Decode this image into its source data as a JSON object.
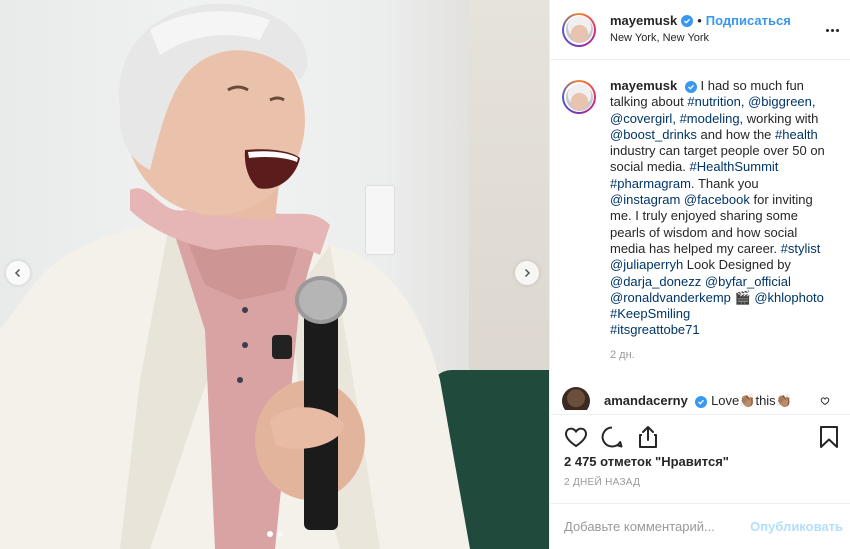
{
  "post": {
    "username": "mayemusk",
    "follow_label": "Подписаться",
    "separator": "•",
    "location": "New York, New York",
    "caption_lines": [
      "I had so much fun",
      "talking about #nutrition, @biggreen,",
      "@covergirl, #modeling, working with",
      "@boost_drinks and how the #health",
      "industry can target people over 50 on",
      "social media. #HealthSummit",
      "#pharmagram. Thank you",
      "@instagram @facebook for inviting",
      "me. I truly enjoyed sharing some",
      "pearls of wisdom and how social",
      "media has helped my career. #stylist",
      "@juliaperryh Look Designed by",
      "@darja_donezz @byfar_official",
      "@ronaldvanderkemp 🎬 @khlophoto",
      "#KeepSmiling",
      "#itsgreattobe71"
    ],
    "caption_time": "2 дн.",
    "likes_text": "2 475 отметок \"Нравится\"",
    "date_text": "2 ДНЕЙ НАЗАД"
  },
  "comment": {
    "username": "amandacerny",
    "text": "Love👏🏽this👏🏽"
  },
  "add_comment": {
    "placeholder": "Добавьте комментарий...",
    "publish_label": "Опубликовать"
  },
  "carousel": {
    "slide_count": 2,
    "active_slide": 1
  },
  "colors": {
    "accent": "#3897f0",
    "link": "#003569",
    "muted": "#999999",
    "publish_disabled": "#b2dffc"
  },
  "icons": {
    "prev": "chevron-left-icon",
    "next": "chevron-right-icon",
    "like": "heart-icon",
    "comment": "comment-bubble-icon",
    "share": "share-icon",
    "save": "bookmark-icon",
    "more": "more-dots-icon",
    "verified": "verified-badge-icon"
  }
}
